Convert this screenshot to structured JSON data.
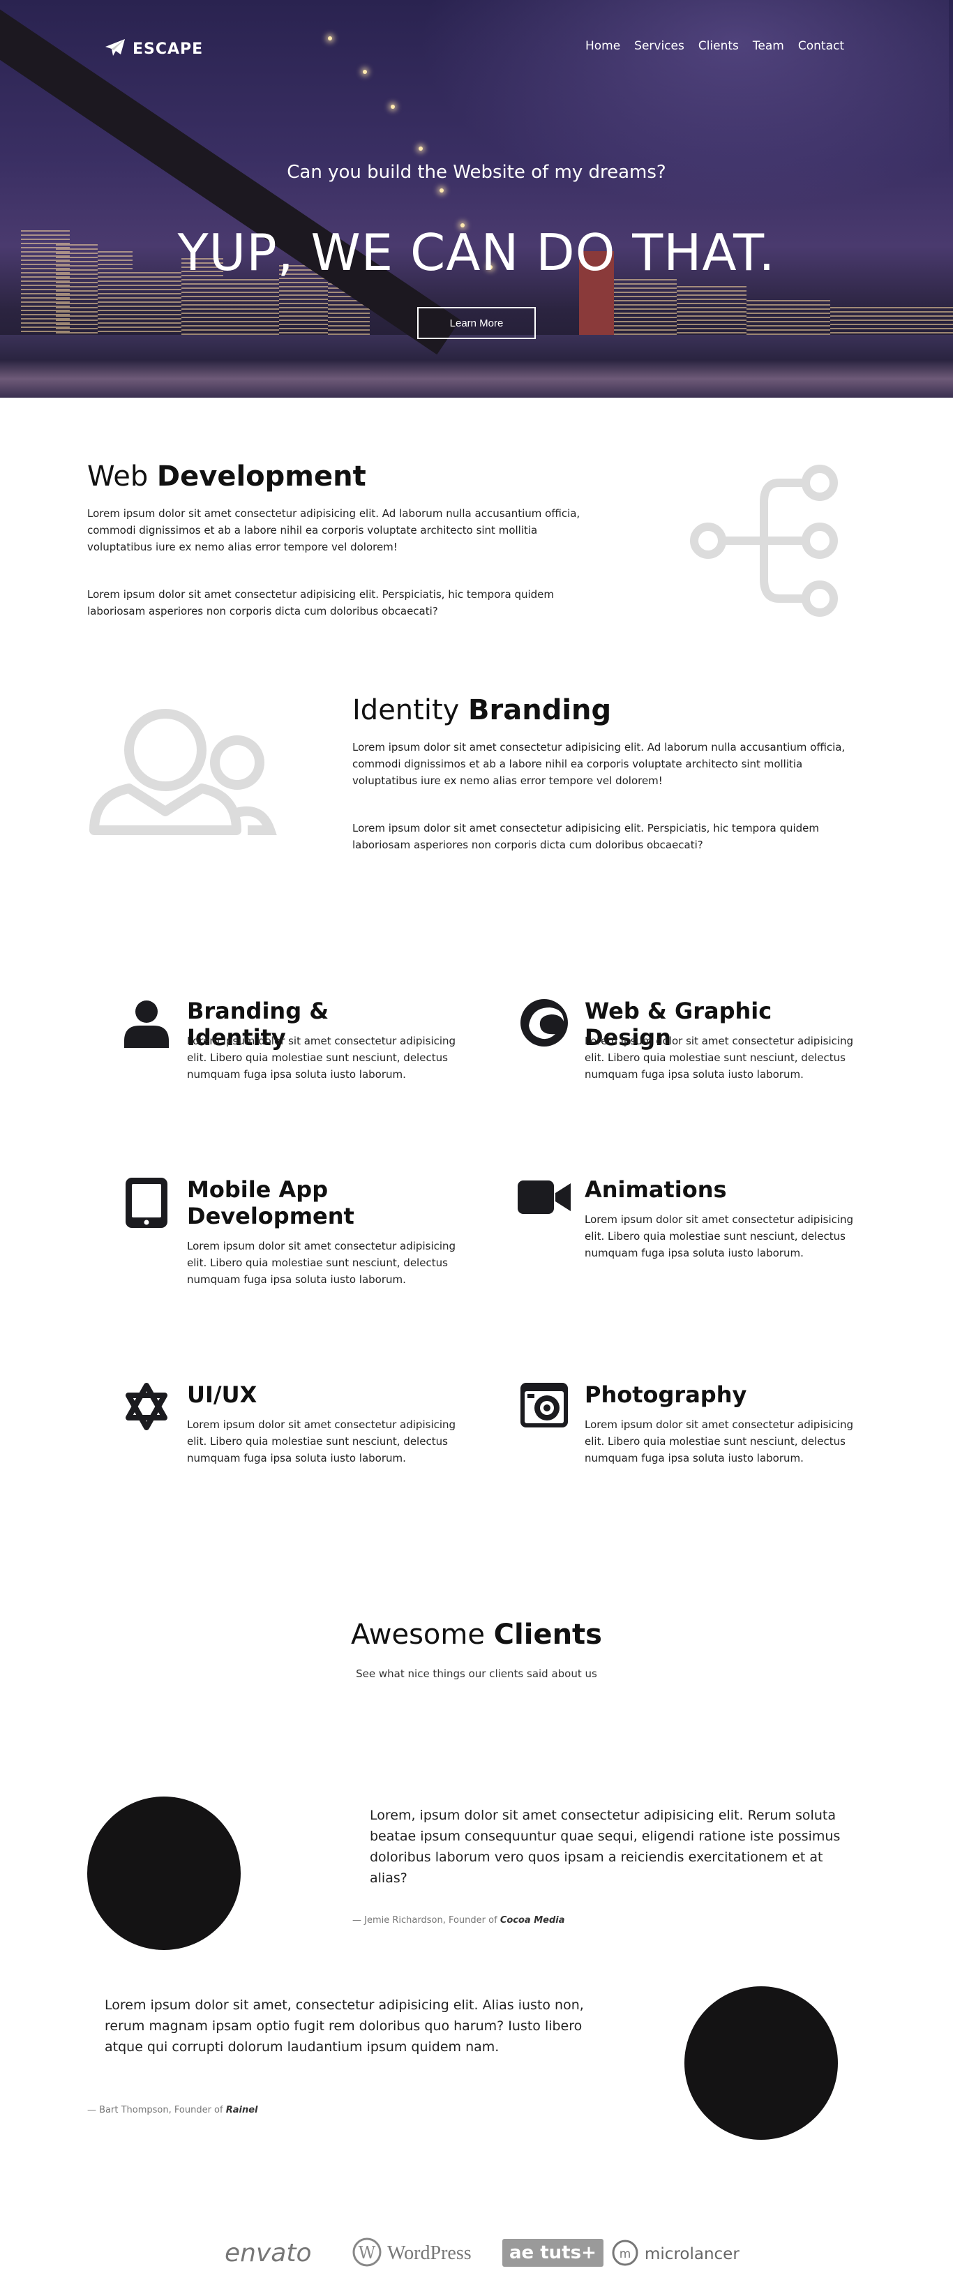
{
  "brand": {
    "name": "ESCAPE"
  },
  "nav": {
    "items": [
      "Home",
      "Services",
      "Clients",
      "Team",
      "Contact"
    ]
  },
  "hero": {
    "subtitle": "Can you build the Website of my dreams?",
    "title": "YUP, WE CAN DO THAT.",
    "button": "Learn More"
  },
  "features": [
    {
      "title_light": "Web ",
      "title_bold": "Development",
      "p1": "Lorem ipsum dolor sit amet consectetur adipisicing elit. Ad laborum nulla accusantium officia, commodi dignissimos et ab a labore nihil ea corporis voluptate architecto sint mollitia voluptatibus iure ex nemo alias error tempore vel dolorem!",
      "p2": "Lorem ipsum dolor sit amet consectetur adipisicing elit. Perspiciatis, hic tempora quidem laboriosam asperiores non corporis dicta cum doloribus obcaecati?",
      "icon": "sitemap-icon"
    },
    {
      "title_light": "Identity ",
      "title_bold": "Branding",
      "p1": "Lorem ipsum dolor sit amet consectetur adipisicing elit. Ad laborum nulla accusantium officia, commodi dignissimos et ab a labore nihil ea corporis voluptate architecto sint mollitia voluptatibus iure ex nemo alias error tempore vel dolorem!",
      "p2": "Lorem ipsum dolor sit amet consectetur adipisicing elit. Perspiciatis, hic tempora quidem laboriosam asperiores non corporis dicta cum doloribus obcaecati?",
      "icon": "users-icon"
    }
  ],
  "services": [
    {
      "title": "Branding & Identity",
      "text": "Lorem ipsum dolor sit amet consectetur adipisicing elit. Libero quia molestiae sunt nesciunt, delectus numquam fuga ipsa soluta iusto laborum.",
      "icon": "user-icon"
    },
    {
      "title": "Web & Graphic Design",
      "text": "Lorem ipsum dolor sit amet consectetur adipisicing elit. Libero quia molestiae sunt nesciunt, delectus numquam fuga ipsa soluta iusto laborum.",
      "icon": "edge-swirl-icon"
    },
    {
      "title": "Mobile App Development",
      "text": "Lorem ipsum dolor sit amet consectetur adipisicing elit. Libero quia molestiae sunt nesciunt, delectus numquam fuga ipsa soluta iusto laborum.",
      "icon": "tablet-icon"
    },
    {
      "title": "Animations",
      "text": "Lorem ipsum dolor sit amet consectetur adipisicing elit. Libero quia molestiae sunt nesciunt, delectus numquam fuga ipsa soluta iusto laborum.",
      "icon": "video-camera-icon"
    },
    {
      "title": "UI/UX",
      "text": "Lorem ipsum dolor sit amet consectetur adipisicing elit. Libero quia molestiae sunt nesciunt, delectus numquam fuga ipsa soluta iusto laborum.",
      "icon": "star-of-david-icon"
    },
    {
      "title": "Photography",
      "text": "Lorem ipsum dolor sit amet consectetur adipisicing elit. Libero quia molestiae sunt nesciunt, delectus numquam fuga ipsa soluta iusto laborum.",
      "icon": "camera-icon"
    }
  ],
  "clients": {
    "title_light": "Awesome ",
    "title_bold": "Clients",
    "subtitle": "See what nice things our clients said about us",
    "testimonials": [
      {
        "quote": "Lorem, ipsum dolor sit amet consectetur adipisicing elit. Rerum soluta beatae ipsum consequuntur quae sequi, eligendi ratione iste possimus doloribus laborum vero quos ipsam a reiciendis exercitationem et at alias?",
        "cite_prefix": "— Jemie Richardson, Founder of ",
        "company": "Cocoa Media"
      },
      {
        "quote": "Lorem ipsum dolor sit amet, consectetur adipisicing elit. Alias iusto non, rerum magnam ipsam optio fugit rem doloribus quo harum? Iusto libero atque qui corrupti dolorum laudantium ipsum quidem nam.",
        "cite_prefix": "— Bart Thompson, Founder of ",
        "company": "Rainel"
      }
    ]
  },
  "partners": [
    "envato",
    "WordPress",
    "ae tuts+",
    "microlancer"
  ],
  "colors": {
    "hero_overlay": "#3a2f63",
    "icon_gray": "#dcdcdc",
    "icon_dark": "#1b1b1f"
  }
}
